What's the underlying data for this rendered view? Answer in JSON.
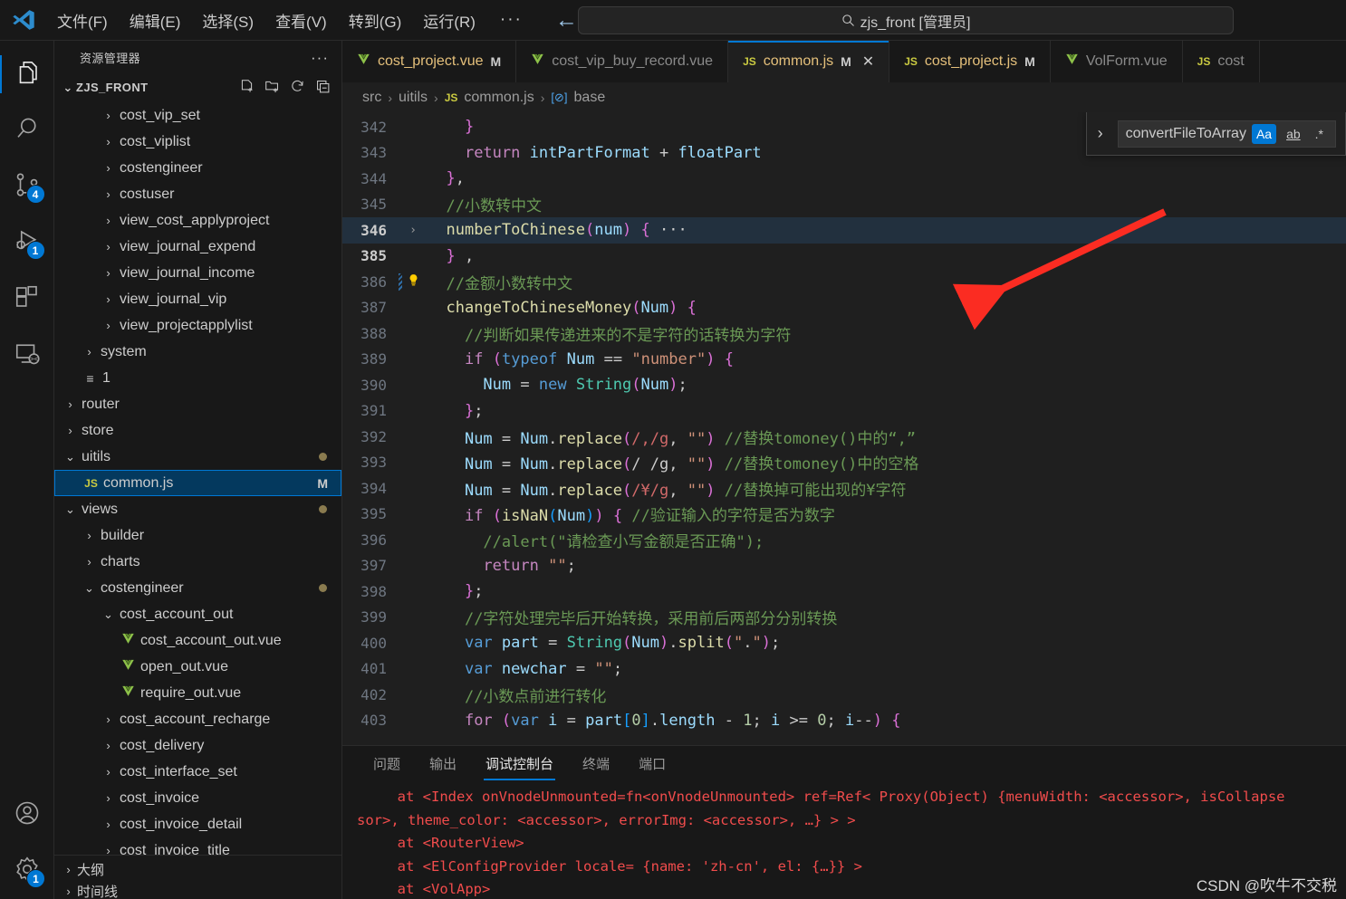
{
  "titlebar": {
    "logo": "vscode-logo",
    "menus": [
      "文件(F)",
      "编辑(E)",
      "选择(S)",
      "查看(V)",
      "转到(G)",
      "运行(R)"
    ],
    "more": "···",
    "nav_back": "←",
    "nav_forward": "→",
    "quick_input": {
      "icon": "search-icon",
      "text": "zjs_front [管理员]"
    }
  },
  "activitybar": {
    "items": [
      {
        "name": "explorer",
        "icon": "files-icon",
        "badge": null,
        "active": true
      },
      {
        "name": "search",
        "icon": "search-icon",
        "badge": null,
        "active": false
      },
      {
        "name": "source-control",
        "icon": "source-control-icon",
        "badge": "4",
        "active": false
      },
      {
        "name": "run-and-debug",
        "icon": "run-debug-icon",
        "badge": "1",
        "active": false
      },
      {
        "name": "extensions",
        "icon": "extensions-icon",
        "badge": null,
        "active": false
      },
      {
        "name": "remote-explorer",
        "icon": "remote-icon",
        "badge": null,
        "active": false
      }
    ],
    "bottom": [
      {
        "name": "accounts",
        "icon": "account-icon",
        "badge": null
      },
      {
        "name": "settings",
        "icon": "gear-icon",
        "badge": "1"
      }
    ]
  },
  "sidebar": {
    "title": "资源管理器",
    "more": "···",
    "root": {
      "label": "ZJS_FRONT",
      "caret": "⌄"
    },
    "actions": [
      "new-file-icon",
      "new-folder-icon",
      "refresh-icon",
      "collapse-all-icon"
    ],
    "tree": [
      {
        "label": "cost_vip_set",
        "type": "folder",
        "indent": 3,
        "expanded": false
      },
      {
        "label": "cost_viplist",
        "type": "folder",
        "indent": 3,
        "expanded": false
      },
      {
        "label": "costengineer",
        "type": "folder",
        "indent": 3,
        "expanded": false
      },
      {
        "label": "costuser",
        "type": "folder",
        "indent": 3,
        "expanded": false
      },
      {
        "label": "view_cost_applyproject",
        "type": "folder",
        "indent": 3,
        "expanded": false
      },
      {
        "label": "view_journal_expend",
        "type": "folder",
        "indent": 3,
        "expanded": false
      },
      {
        "label": "view_journal_income",
        "type": "folder",
        "indent": 3,
        "expanded": false
      },
      {
        "label": "view_journal_vip",
        "type": "folder",
        "indent": 3,
        "expanded": false
      },
      {
        "label": "view_projectapplylist",
        "type": "folder",
        "indent": 3,
        "expanded": false
      },
      {
        "label": "system",
        "type": "folder",
        "indent": 2,
        "expanded": false
      },
      {
        "label": "1",
        "type": "outline",
        "indent": 2,
        "expanded": false
      },
      {
        "label": "router",
        "type": "folder",
        "indent": 1,
        "expanded": false
      },
      {
        "label": "store",
        "type": "folder",
        "indent": 1,
        "expanded": false
      },
      {
        "label": "uitils",
        "type": "folder",
        "indent": 1,
        "expanded": true,
        "dot": true
      },
      {
        "label": "common.js",
        "type": "js",
        "indent": 2,
        "selected": true,
        "flag": "M"
      },
      {
        "label": "views",
        "type": "folder",
        "indent": 1,
        "expanded": true,
        "dot": true
      },
      {
        "label": "builder",
        "type": "folder",
        "indent": 2,
        "expanded": false
      },
      {
        "label": "charts",
        "type": "folder",
        "indent": 2,
        "expanded": false
      },
      {
        "label": "costengineer",
        "type": "folder",
        "indent": 2,
        "expanded": true,
        "dot": true
      },
      {
        "label": "cost_account_out",
        "type": "folder",
        "indent": 3,
        "expanded": true
      },
      {
        "label": "cost_account_out.vue",
        "type": "vue",
        "indent": 4
      },
      {
        "label": "open_out.vue",
        "type": "vue",
        "indent": 4
      },
      {
        "label": "require_out.vue",
        "type": "vue",
        "indent": 4
      },
      {
        "label": "cost_account_recharge",
        "type": "folder",
        "indent": 3,
        "expanded": false
      },
      {
        "label": "cost_delivery",
        "type": "folder",
        "indent": 3,
        "expanded": false
      },
      {
        "label": "cost_interface_set",
        "type": "folder",
        "indent": 3,
        "expanded": false
      },
      {
        "label": "cost_invoice",
        "type": "folder",
        "indent": 3,
        "expanded": false
      },
      {
        "label": "cost_invoice_detail",
        "type": "folder",
        "indent": 3,
        "expanded": false
      },
      {
        "label": "cost_invoice_title",
        "type": "folder",
        "indent": 3,
        "expanded": false
      }
    ],
    "footer": [
      {
        "label": "大纲",
        "caret": "›"
      },
      {
        "label": "时间线",
        "caret": "›"
      }
    ]
  },
  "tabs": [
    {
      "label": "cost_project.vue",
      "icon": "vue-icon",
      "flag": "M",
      "active": false,
      "closable": false
    },
    {
      "label": "cost_vip_buy_record.vue",
      "icon": "vue-icon",
      "flag": "",
      "active": false,
      "closable": false
    },
    {
      "label": "common.js",
      "icon": "js-icon",
      "flag": "M",
      "active": true,
      "closable": true,
      "close": "✕"
    },
    {
      "label": "cost_project.js",
      "icon": "js-icon",
      "flag": "M",
      "active": false,
      "closable": false
    },
    {
      "label": "VolForm.vue",
      "icon": "vue-icon",
      "flag": "",
      "active": false,
      "closable": false
    },
    {
      "label": "cost",
      "icon": "js-icon",
      "flag": "",
      "active": false,
      "closable": false
    }
  ],
  "breadcrumb": {
    "parts": [
      "src",
      "uitils",
      "common.js",
      "base"
    ],
    "sep": "›",
    "js_badge": "JS",
    "symbol_badge": "[⊘]"
  },
  "find_widget": {
    "toggle": "›",
    "query": "convertFileToArray",
    "match_case": "Aa",
    "whole_word": "ab",
    "regex": ".*"
  },
  "code": {
    "lines": [
      {
        "n": "342",
        "indent_bar": false,
        "modified": false,
        "fold": "",
        "bulb": false,
        "hl": false
      },
      {
        "n": "343",
        "indent_bar": false,
        "modified": false,
        "fold": "",
        "bulb": false,
        "hl": false
      },
      {
        "n": "344",
        "indent_bar": false,
        "modified": false,
        "fold": "",
        "bulb": false,
        "hl": false
      },
      {
        "n": "345",
        "indent_bar": false,
        "modified": true,
        "fold": "",
        "bulb": false,
        "hl": false
      },
      {
        "n": "346",
        "indent_bar": false,
        "modified": false,
        "fold": "›",
        "bulb": false,
        "hl": true
      },
      {
        "n": "385",
        "indent_bar": false,
        "modified": true,
        "fold": "",
        "bulb": false,
        "hl": false,
        "current": true
      },
      {
        "n": "386",
        "indent_bar": false,
        "modified": true,
        "fold": "",
        "bulb": true,
        "hl": false
      },
      {
        "n": "387",
        "indent_bar": false,
        "modified": true,
        "fold": "",
        "bulb": false,
        "hl": false
      },
      {
        "n": "388",
        "indent_bar": false,
        "modified": true,
        "fold": "",
        "bulb": false,
        "hl": false
      },
      {
        "n": "389",
        "indent_bar": false,
        "modified": true,
        "fold": "",
        "bulb": false,
        "hl": false
      },
      {
        "n": "390",
        "indent_bar": false,
        "modified": true,
        "fold": "",
        "bulb": false,
        "hl": false
      },
      {
        "n": "391",
        "indent_bar": false,
        "modified": true,
        "fold": "",
        "bulb": false,
        "hl": false
      },
      {
        "n": "392",
        "indent_bar": false,
        "modified": true,
        "fold": "",
        "bulb": false,
        "hl": false
      },
      {
        "n": "393",
        "indent_bar": false,
        "modified": true,
        "fold": "",
        "bulb": false,
        "hl": false
      },
      {
        "n": "394",
        "indent_bar": false,
        "modified": true,
        "fold": "",
        "bulb": false,
        "hl": false
      },
      {
        "n": "395",
        "indent_bar": false,
        "modified": true,
        "fold": "",
        "bulb": false,
        "hl": false
      },
      {
        "n": "396",
        "indent_bar": false,
        "modified": true,
        "fold": "",
        "bulb": false,
        "hl": false
      },
      {
        "n": "397",
        "indent_bar": false,
        "modified": true,
        "fold": "",
        "bulb": false,
        "hl": false
      },
      {
        "n": "398",
        "indent_bar": false,
        "modified": true,
        "fold": "",
        "bulb": false,
        "hl": false
      },
      {
        "n": "399",
        "indent_bar": false,
        "modified": true,
        "fold": "",
        "bulb": false,
        "hl": false
      },
      {
        "n": "400",
        "indent_bar": false,
        "modified": true,
        "fold": "",
        "bulb": false,
        "hl": false
      },
      {
        "n": "401",
        "indent_bar": false,
        "modified": true,
        "fold": "",
        "bulb": false,
        "hl": false
      },
      {
        "n": "402",
        "indent_bar": false,
        "modified": true,
        "fold": "",
        "bulb": false,
        "hl": false
      },
      {
        "n": "403",
        "indent_bar": false,
        "modified": true,
        "fold": "",
        "bulb": false,
        "hl": false
      }
    ],
    "text": [
      "    }",
      "    return intPartFormat + floatPart",
      "  },",
      "  //小数转中文",
      "  numberToChinese(num) { ···",
      "  } ,",
      "  //金额小数转中文",
      "  changeToChineseMoney(Num) {",
      "    //判断如果传递进来的不是字符的话转换为字符",
      "    if (typeof Num == \"number\") {",
      "      Num = new String(Num);",
      "    };",
      "    Num = Num.replace(/,/g, \"\") //替换tomoney()中的“,”",
      "    Num = Num.replace(/ /g, \"\") //替换tomoney()中的空格",
      "    Num = Num.replace(/¥/g, \"\") //替换掉可能出现的¥字符",
      "    if (isNaN(Num)) { //验证输入的字符是否为数字",
      "      //alert(\"请检查小写金额是否正确\");",
      "      return \"\";",
      "    };",
      "    //字符处理完毕后开始转换，采用前后两部分分别转换",
      "    var part = String(Num).split(\".\");",
      "    var newchar = \"\";",
      "    //小数点前进行转化",
      "    for (var i = part[0].length - 1; i >= 0; i--) {"
    ]
  },
  "panel": {
    "tabs": [
      {
        "label": "问题",
        "active": false
      },
      {
        "label": "输出",
        "active": false
      },
      {
        "label": "调试控制台",
        "active": true
      },
      {
        "label": "终端",
        "active": false
      },
      {
        "label": "端口",
        "active": false
      }
    ],
    "lines": [
      "  at <Index onVnodeUnmounted=fn<onVnodeUnmounted> ref=Ref< Proxy(Object) {menuWidth: <accessor>, isCollapse",
      "sor>, theme_color: <accessor>, errorImg: <accessor>, …} > >",
      "  at <RouterView>",
      "  at <ElConfigProvider locale= {name: 'zh-cn', el: {…}} >",
      "  at <VolApp>"
    ],
    "watermark": "CSDN @吹牛不交税"
  },
  "colors": {
    "accent": "#0078d4",
    "selection": "#04395e",
    "error": "#f14c4c",
    "comment": "#6a9955",
    "string": "#ce9178",
    "function": "#dcdcaa",
    "keyword": "#c586c0",
    "annotation_arrow": "#fb2c22"
  }
}
